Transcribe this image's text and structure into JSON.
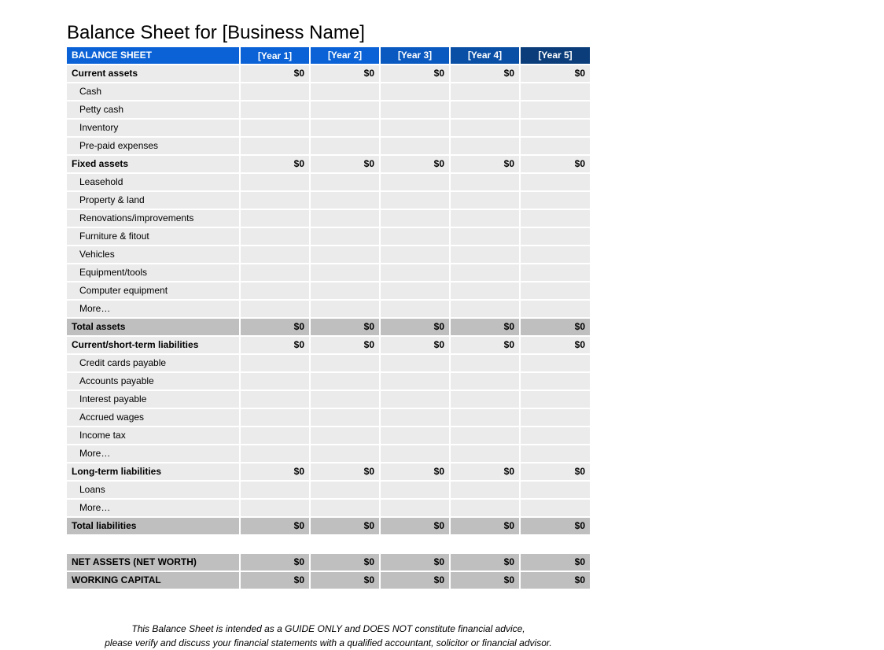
{
  "title": "Balance Sheet for [Business Name]",
  "header": {
    "main": "BALANCE SHEET",
    "years": [
      "[Year 1]",
      "[Year 2]",
      "[Year 3]",
      "[Year 4]",
      "[Year 5]"
    ]
  },
  "sections": [
    {
      "label": "Current assets",
      "totals": [
        "$0",
        "$0",
        "$0",
        "$0",
        "$0"
      ],
      "items": [
        {
          "label": "Cash",
          "values": [
            "",
            "",
            "",
            "",
            ""
          ]
        },
        {
          "label": "Petty cash",
          "values": [
            "",
            "",
            "",
            "",
            ""
          ]
        },
        {
          "label": "Inventory",
          "values": [
            "",
            "",
            "",
            "",
            ""
          ]
        },
        {
          "label": "Pre-paid expenses",
          "values": [
            "",
            "",
            "",
            "",
            ""
          ]
        }
      ]
    },
    {
      "label": "Fixed assets",
      "totals": [
        "$0",
        "$0",
        "$0",
        "$0",
        "$0"
      ],
      "items": [
        {
          "label": "Leasehold",
          "values": [
            "",
            "",
            "",
            "",
            ""
          ]
        },
        {
          "label": "Property & land",
          "values": [
            "",
            "",
            "",
            "",
            ""
          ]
        },
        {
          "label": "Renovations/improvements",
          "values": [
            "",
            "",
            "",
            "",
            ""
          ]
        },
        {
          "label": "Furniture & fitout",
          "values": [
            "",
            "",
            "",
            "",
            ""
          ]
        },
        {
          "label": "Vehicles",
          "values": [
            "",
            "",
            "",
            "",
            ""
          ]
        },
        {
          "label": "Equipment/tools",
          "values": [
            "",
            "",
            "",
            "",
            ""
          ]
        },
        {
          "label": "Computer equipment",
          "values": [
            "",
            "",
            "",
            "",
            ""
          ]
        },
        {
          "label": "More…",
          "values": [
            "",
            "",
            "",
            "",
            ""
          ]
        }
      ]
    }
  ],
  "total_assets": {
    "label": "Total assets",
    "values": [
      "$0",
      "$0",
      "$0",
      "$0",
      "$0"
    ]
  },
  "liabilities": [
    {
      "label": "Current/short-term liabilities",
      "totals": [
        "$0",
        "$0",
        "$0",
        "$0",
        "$0"
      ],
      "items": [
        {
          "label": "Credit cards payable",
          "values": [
            "",
            "",
            "",
            "",
            ""
          ]
        },
        {
          "label": "Accounts payable",
          "values": [
            "",
            "",
            "",
            "",
            ""
          ]
        },
        {
          "label": "Interest payable",
          "values": [
            "",
            "",
            "",
            "",
            ""
          ]
        },
        {
          "label": "Accrued wages",
          "values": [
            "",
            "",
            "",
            "",
            ""
          ]
        },
        {
          "label": "Income tax",
          "values": [
            "",
            "",
            "",
            "",
            ""
          ]
        },
        {
          "label": "More…",
          "values": [
            "",
            "",
            "",
            "",
            ""
          ]
        }
      ]
    },
    {
      "label": "Long-term liabilities",
      "totals": [
        "$0",
        "$0",
        "$0",
        "$0",
        "$0"
      ],
      "items": [
        {
          "label": "Loans",
          "values": [
            "",
            "",
            "",
            "",
            ""
          ]
        },
        {
          "label": "More…",
          "values": [
            "",
            "",
            "",
            "",
            ""
          ]
        }
      ]
    }
  ],
  "total_liabilities": {
    "label": "Total liabilities",
    "values": [
      "$0",
      "$0",
      "$0",
      "$0",
      "$0"
    ]
  },
  "summary": [
    {
      "label": "NET ASSETS (NET WORTH)",
      "values": [
        "$0",
        "$0",
        "$0",
        "$0",
        "$0"
      ]
    },
    {
      "label": "WORKING CAPITAL",
      "values": [
        "$0",
        "$0",
        "$0",
        "$0",
        "$0"
      ]
    }
  ],
  "disclaimer": {
    "line1": "This Balance Sheet is intended as a GUIDE ONLY and DOES NOT constitute financial advice,",
    "line2": "please verify and discuss your financial statements with a qualified accountant, solicitor or financial advisor."
  }
}
